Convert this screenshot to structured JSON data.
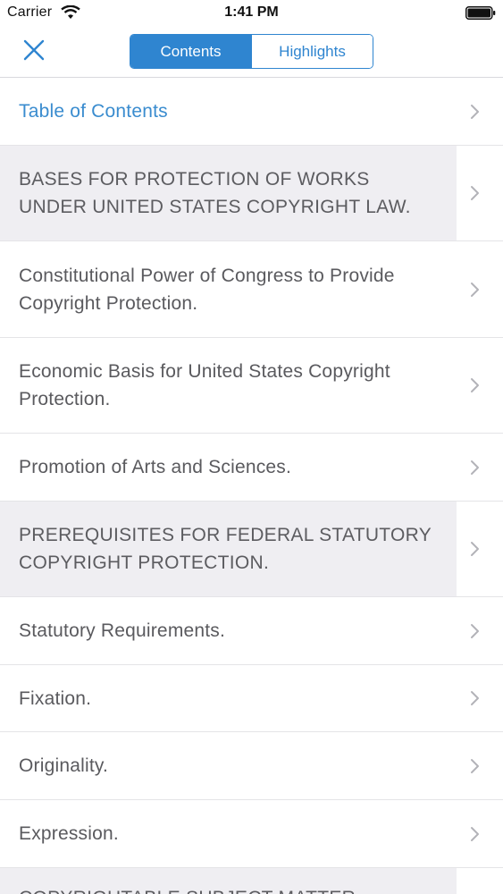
{
  "status_bar": {
    "carrier": "Carrier",
    "time": "1:41 PM"
  },
  "nav": {
    "close_icon": "close-icon",
    "tabs": [
      {
        "label": "Contents",
        "selected": true
      },
      {
        "label": "Highlights",
        "selected": false
      }
    ]
  },
  "list": {
    "items": [
      {
        "label": "Table of Contents",
        "kind": "toc"
      },
      {
        "label": "BASES FOR PROTECTION OF WORKS UNDER UNITED STATES COPYRIGHT LAW.",
        "kind": "section"
      },
      {
        "label": "Constitutional Power of Congress to Provide Copyright Protection.",
        "kind": "item"
      },
      {
        "label": "Economic Basis for United States Copyright Protection.",
        "kind": "item"
      },
      {
        "label": "Promotion of Arts and Sciences.",
        "kind": "item"
      },
      {
        "label": "PREREQUISITES FOR FEDERAL STATUTORY COPYRIGHT PROTECTION.",
        "kind": "section"
      },
      {
        "label": "Statutory Requirements.",
        "kind": "item"
      },
      {
        "label": "Fixation.",
        "kind": "item"
      },
      {
        "label": "Originality.",
        "kind": "item"
      },
      {
        "label": "Expression.",
        "kind": "item"
      },
      {
        "label": "COPYRIGHTABLE SUBJECT MATTER",
        "kind": "section"
      }
    ]
  },
  "colors": {
    "accent": "#2f85d0",
    "section_bg": "#efeef2",
    "text": "#5a5a5e"
  }
}
